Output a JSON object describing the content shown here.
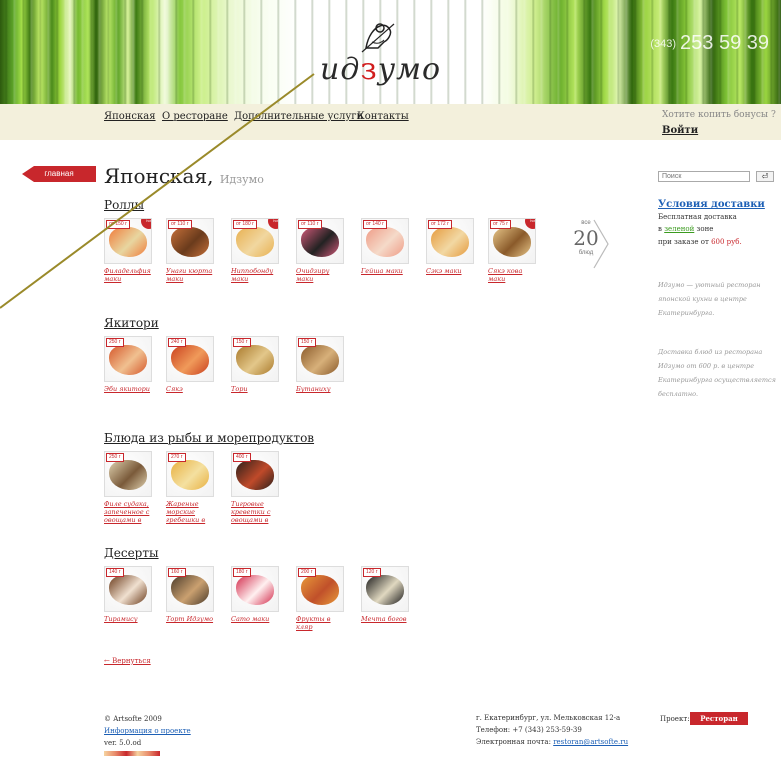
{
  "header": {
    "logo_text_pre": "ид",
    "logo_text_red": "з",
    "logo_text_post": "умо",
    "phone_prefix": "(343)",
    "phone_number": "253 59 39"
  },
  "nav": {
    "items": [
      {
        "label": "Японская"
      },
      {
        "label": "О ресторане"
      },
      {
        "label": "Дополнительные услуги"
      },
      {
        "label": "Контакты"
      }
    ],
    "bonus_text": "Хотите копить бонусы ?",
    "login_label": "Войти"
  },
  "page": {
    "main_tab": "главная",
    "title": "Японская,",
    "subtitle": "Идзумо"
  },
  "sections": [
    {
      "title": "Роллы",
      "dishes": [
        {
          "name": "Филадельфия маки",
          "weight": "от 150 г",
          "badge": "hot",
          "colors": [
            "#f07b3a",
            "#e8d6a0"
          ]
        },
        {
          "name": "Унаги кюрта маки",
          "weight": "от 110 г",
          "badge": "",
          "colors": [
            "#c6703a",
            "#6a3b1c"
          ]
        },
        {
          "name": "Ниппобонду маки",
          "weight": "от 180 г",
          "badge": "hot",
          "colors": [
            "#e8b050",
            "#f1d7a0"
          ]
        },
        {
          "name": "Очидзиру маки",
          "weight": "от 110 г",
          "badge": "",
          "colors": [
            "#d45a7a",
            "#222"
          ]
        },
        {
          "name": "Гейша маки",
          "weight": "от 140 г",
          "badge": "",
          "colors": [
            "#ef9b86",
            "#f5dac9"
          ]
        },
        {
          "name": "Сэкэ маки",
          "weight": "от 172 г",
          "badge": "",
          "colors": [
            "#e59a3c",
            "#f2d8a3"
          ]
        },
        {
          "name": "Сякэ кова маки",
          "weight": "от 75 г",
          "badge": "hot",
          "colors": [
            "#e8c78a",
            "#8a5a2a"
          ]
        }
      ],
      "more": {
        "top": "все",
        "count": "20",
        "bottom": "блюд"
      }
    },
    {
      "title": "Якитори",
      "dishes": [
        {
          "name": "Эби якитори",
          "weight": "250 г",
          "badge": "",
          "colors": [
            "#d5572a",
            "#f0c090"
          ]
        },
        {
          "name": "Сякэ",
          "weight": "240 г",
          "badge": "",
          "colors": [
            "#c9401e",
            "#f09a5a"
          ]
        },
        {
          "name": "Тори",
          "weight": "150 г",
          "badge": "",
          "colors": [
            "#a9792a",
            "#e3c78a"
          ]
        },
        {
          "name": "Бутаниху",
          "weight": "150 г",
          "badge": "",
          "colors": [
            "#8a5a2a",
            "#d7b07a"
          ]
        }
      ]
    },
    {
      "title": "Блюда из рыбы и морепродуктов",
      "dishes": [
        {
          "name": "Филе судака, запеченное с овощами в",
          "weight": "250 г",
          "badge": "",
          "colors": [
            "#e0d2b0",
            "#7a5a3a"
          ]
        },
        {
          "name": "Жареные морские гребешки в",
          "weight": "270 г",
          "badge": "",
          "colors": [
            "#e8b040",
            "#f4e0a0"
          ]
        },
        {
          "name": "Тигровые креветки с овощами в",
          "weight": "400 г",
          "badge": "",
          "colors": [
            "#2a1f1a",
            "#c04a2a"
          ]
        }
      ]
    },
    {
      "title": "Десерты",
      "dishes": [
        {
          "name": "Тирамису",
          "weight": "140 г",
          "badge": "",
          "colors": [
            "#6a3a1a",
            "#f0e0d0"
          ]
        },
        {
          "name": "Торт Идзумо",
          "weight": "160 г",
          "badge": "",
          "colors": [
            "#4a3a2a",
            "#caa070"
          ]
        },
        {
          "name": "Сато маки",
          "weight": "180 г",
          "badge": "",
          "colors": [
            "#d22a4a",
            "#fff0f0"
          ]
        },
        {
          "name": "Фрукты в кляр",
          "weight": "200 г",
          "badge": "",
          "colors": [
            "#e89a3a",
            "#c0502a"
          ]
        },
        {
          "name": "Мечта богов",
          "weight": "120 г",
          "badge": "",
          "colors": [
            "#1a1a1a",
            "#e0d8c0"
          ]
        }
      ]
    }
  ],
  "right": {
    "search_placeholder": "Поиск",
    "search_button": "⏎",
    "delivery_title": "Условия доставки",
    "delivery_l1": "Бесплатная доставка",
    "delivery_l2_pre": "в",
    "delivery_l2_link": "зеленой",
    "delivery_l2_post": "зоне",
    "delivery_l3_pre": "при заказе от",
    "delivery_l3_price": "600 руб.",
    "note1": "Идзумо — уютный ресторан японской кухни в центре Екатеринбурга.",
    "note2": "Доставка блюд из ресторана Идзумо от 600 р. в центре Екатеринбурга осуществляется бесплатно."
  },
  "footer": {
    "back_label": "← Вернуться",
    "copyright": "© Artsofte 2009",
    "info_link": "Информация о проекте",
    "version": "ver. 5.0.od",
    "address": "г. Екатеринбург, ул. Мельковская 12-а",
    "phone": "Телефон: +7 (343) 253-59-39",
    "email_label": "Электронная почта:",
    "email": "restoran@artsofte.ru",
    "project_label": "Проект:",
    "project_badge": "Ресторан"
  },
  "colors": {
    "accent_red": "#c8272c",
    "link_blue": "#1c5fb5",
    "nav_bg": "#f3f0dc",
    "banner_green": "#6aae2b",
    "annotation_line": "#9a8a2a"
  }
}
